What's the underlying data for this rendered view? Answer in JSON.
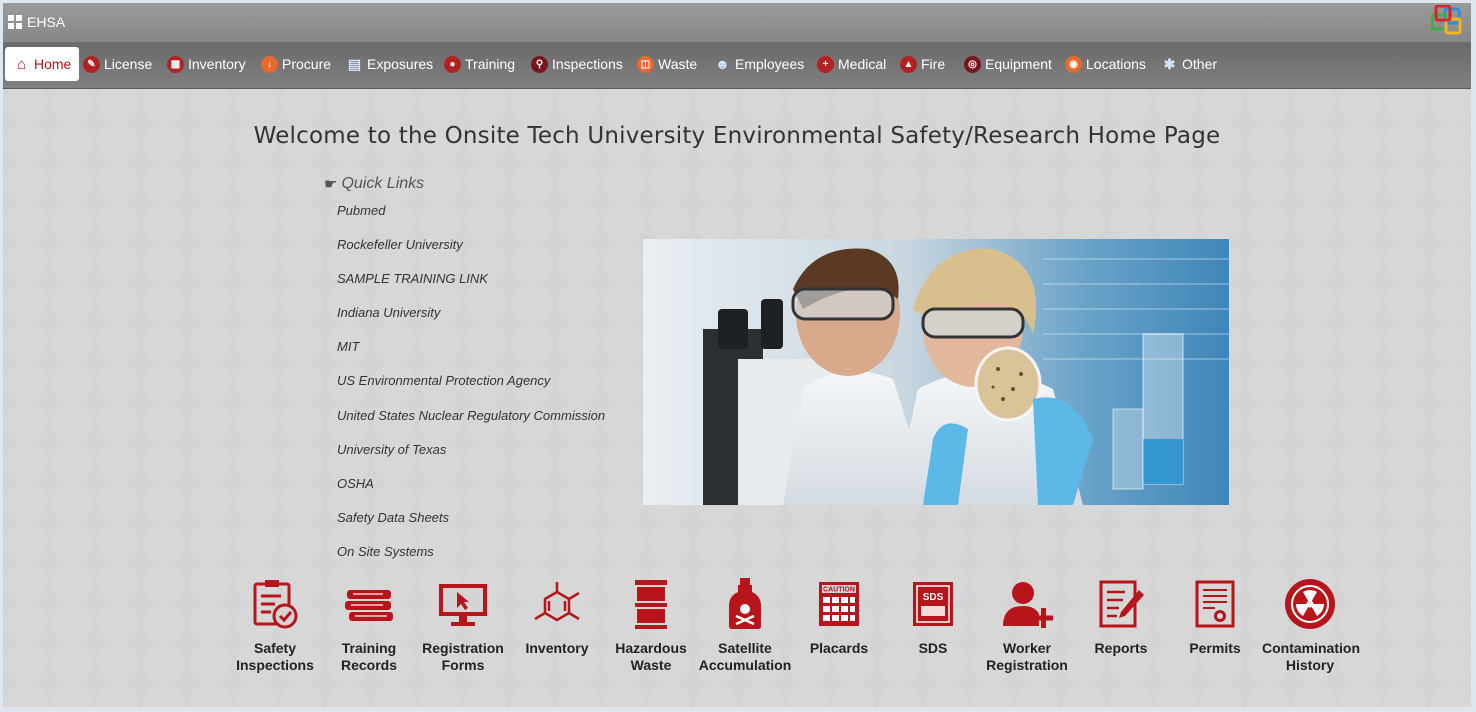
{
  "app": {
    "title": "EHSA"
  },
  "nav": {
    "items": [
      {
        "label": "Home",
        "icon": "home-icon"
      },
      {
        "label": "License",
        "icon": "wrench-icon"
      },
      {
        "label": "Inventory",
        "icon": "truck-icon"
      },
      {
        "label": "Procure",
        "icon": "arrow-down-icon"
      },
      {
        "label": "Exposures",
        "icon": "clipboard-icon"
      },
      {
        "label": "Training",
        "icon": "person-icon"
      },
      {
        "label": "Inspections",
        "icon": "magnifier-icon"
      },
      {
        "label": "Waste",
        "icon": "trash-icon"
      },
      {
        "label": "Employees",
        "icon": "people-icon"
      },
      {
        "label": "Medical",
        "icon": "medical-cross-icon"
      },
      {
        "label": "Fire",
        "icon": "flame-icon"
      },
      {
        "label": "Equipment",
        "icon": "gauge-icon"
      },
      {
        "label": "Locations",
        "icon": "map-pin-icon"
      },
      {
        "label": "Other",
        "icon": "asterisk-icon"
      }
    ]
  },
  "main": {
    "title": "Welcome to the Onsite Tech University Environmental Safety/Research Home Page",
    "quick_links": {
      "header": "Quick Links",
      "links": [
        "Pubmed",
        "Rockefeller University",
        "SAMPLE TRAINING LINK",
        "Indiana University",
        "MIT",
        "US Environmental Protection Agency",
        "United States Nuclear Regulatory Commission",
        "University of Texas",
        "OSHA",
        "Safety Data Sheets",
        "On Site Systems"
      ]
    },
    "tiles": [
      {
        "line1": "Safety",
        "line2": "Inspections",
        "icon": "inspection-checklist-icon"
      },
      {
        "line1": "Training",
        "line2": "Records",
        "icon": "book-stack-icon"
      },
      {
        "line1": "Registration",
        "line2": "Forms",
        "icon": "monitor-cursor-icon"
      },
      {
        "line1": "Inventory",
        "line2": "",
        "icon": "molecule-icon"
      },
      {
        "line1": "Hazardous",
        "line2": "Waste",
        "icon": "barrel-icon"
      },
      {
        "line1": "Satellite",
        "line2": "Accumulation",
        "icon": "poison-bottle-icon"
      },
      {
        "line1": "Placards",
        "line2": "",
        "icon": "caution-placard-icon"
      },
      {
        "line1": "SDS",
        "line2": "",
        "icon": "sds-sheet-icon"
      },
      {
        "line1": "Worker",
        "line2": "Registration",
        "icon": "add-user-icon"
      },
      {
        "line1": "Reports",
        "line2": "",
        "icon": "report-pencil-icon"
      },
      {
        "line1": "Permits",
        "line2": "",
        "icon": "certificate-icon"
      },
      {
        "line1": "Contamination",
        "line2": "History",
        "icon": "radiation-icon"
      }
    ],
    "placard_text": "CAUTION",
    "sds_text": "SDS"
  },
  "colors": {
    "accent": "#b5151b",
    "nav_bg": "#727272",
    "page_bg": "#d4d4d4"
  }
}
